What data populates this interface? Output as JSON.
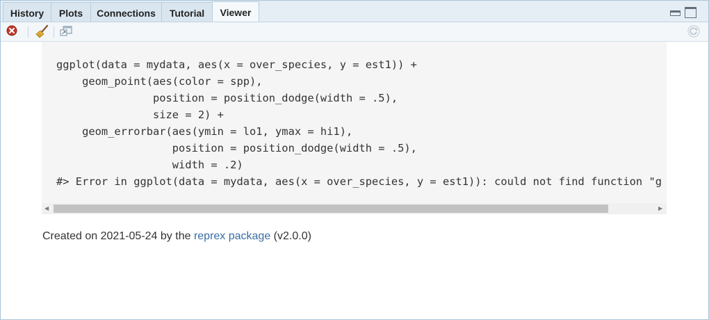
{
  "tabs": [
    {
      "label": "History",
      "active": false
    },
    {
      "label": "Plots",
      "active": false
    },
    {
      "label": "Connections",
      "active": false
    },
    {
      "label": "Tutorial",
      "active": false
    },
    {
      "label": "Viewer",
      "active": true
    }
  ],
  "toolbar": {
    "icons": [
      "remove-icon",
      "broom-clear-icon",
      "popout-window-icon",
      "refresh-icon"
    ]
  },
  "code": {
    "lines": [
      "ggplot(data = mydata, aes(x = over_species, y = est1)) +",
      "    geom_point(aes(color = spp),",
      "               position = position_dodge(width = .5),",
      "               size = 2) +",
      "    geom_errorbar(aes(ymin = lo1, ymax = hi1),",
      "                  position = position_dodge(width = .5),",
      "                  width = .2)",
      "#> Error in ggplot(data = mydata, aes(x = over_species, y = est1)): could not find function \"g"
    ]
  },
  "footer": {
    "prefix": "Created on 2021-05-24 by the ",
    "link_text": "reprex package",
    "suffix": " (v2.0.0)"
  },
  "colors": {
    "accent_link": "#3a6ea5",
    "remove_icon": "#c0392b",
    "tab_active_bg": "#f5f9fc",
    "tab_bg": "#dae6ef"
  }
}
